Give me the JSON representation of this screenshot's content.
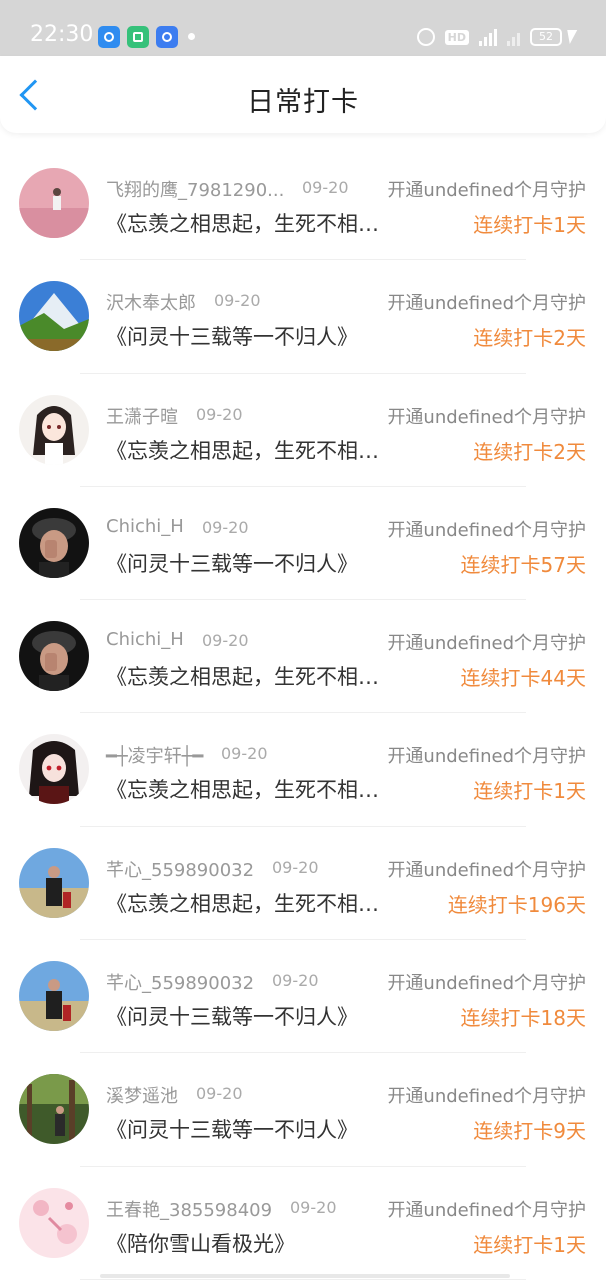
{
  "status_bar": {
    "time": "22:30",
    "battery": "52",
    "network": "4G"
  },
  "header": {
    "title": "日常打卡",
    "accent_color": "#2196f3"
  },
  "streak_color": "#f08a3c",
  "items": [
    {
      "name": "飞翔的鹰_7981290...",
      "date": "09-20",
      "guard": "开通undefined个月守护",
      "content": "《忘羡之相思起，生死不相负》",
      "streak": "连续打卡1天",
      "avatar": "pink-field"
    },
    {
      "name": "沢木奉太郎",
      "date": "09-20",
      "guard": "开通undefined个月守护",
      "content": "《问灵十三载等一不归人》",
      "streak": "连续打卡2天",
      "avatar": "mountain"
    },
    {
      "name": "王潇子暄",
      "date": "09-20",
      "guard": "开通undefined个月守护",
      "content": "《忘羡之相思起，生死不相负》",
      "streak": "连续打卡2天",
      "avatar": "anime-girl"
    },
    {
      "name": "Chichi_H",
      "date": "09-20",
      "guard": "开通undefined个月守护",
      "content": "《问灵十三载等一不归人》",
      "streak": "连续打卡57天",
      "avatar": "dark-portrait"
    },
    {
      "name": "Chichi_H",
      "date": "09-20",
      "guard": "开通undefined个月守护",
      "content": "《忘羡之相思起，生死不相负》",
      "streak": "连续打卡44天",
      "avatar": "dark-portrait"
    },
    {
      "name": "━┼凌宇轩┼━",
      "date": "09-20",
      "guard": "开通undefined个月守护",
      "content": "《忘羡之相思起，生死不相负》",
      "streak": "连续打卡1天",
      "avatar": "anime-dark"
    },
    {
      "name": "芊心_559890032",
      "date": "09-20",
      "guard": "开通undefined个月守护",
      "content": "《忘羡之相思起，生死不相负》",
      "streak": "连续打卡196天",
      "avatar": "outdoor-person"
    },
    {
      "name": "芊心_559890032",
      "date": "09-20",
      "guard": "开通undefined个月守护",
      "content": "《问灵十三载等一不归人》",
      "streak": "连续打卡18天",
      "avatar": "outdoor-person"
    },
    {
      "name": "溪梦遥池",
      "date": "09-20",
      "guard": "开通undefined个月守护",
      "content": "《问灵十三载等一不归人》",
      "streak": "连续打卡9天",
      "avatar": "forest"
    },
    {
      "name": "王春艳_385598409",
      "date": "09-20",
      "guard": "开通undefined个月守护",
      "content": "《陪你雪山看极光》",
      "streak": "连续打卡1天",
      "avatar": "pink-cartoon"
    }
  ]
}
